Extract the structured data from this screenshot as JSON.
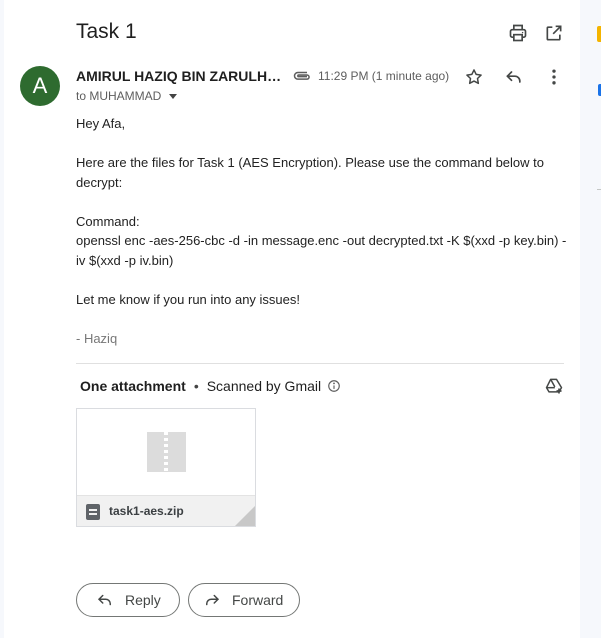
{
  "email": {
    "subject": "Task 1",
    "sender_initial": "A",
    "sender_name": "AMIRUL HAZIQ BIN ZARULHI...",
    "time": "11:29 PM (1 minute ago)",
    "to_line": "to MUHAMMAD",
    "body": [
      "Hey Afa,",
      "",
      "Here are the files for Task 1 (AES Encryption). Please use the command below to decrypt:",
      "",
      "Command:",
      "openssl enc -aes-256-cbc -d -in message.enc -out decrypted.txt -K $(xxd -p key.bin) -iv $(xxd -p iv.bin)",
      "",
      "Let me know if you run into any issues!",
      "",
      "- Haziq"
    ]
  },
  "attachments": {
    "header_count": "One attachment",
    "separator": "•",
    "scanned": "Scanned by Gmail",
    "file_name": "task1-aes.zip"
  },
  "actions": {
    "reply": "Reply",
    "forward": "Forward"
  },
  "icons": {
    "print": "print-icon",
    "open_new": "open-in-new-window-icon",
    "attachment": "paperclip-icon",
    "star": "star-icon",
    "reply": "reply-icon",
    "more": "more-vert-icon",
    "info": "info-icon",
    "drive": "add-to-drive-icon",
    "zip": "zip-file-icon",
    "file": "file-icon",
    "forward": "forward-icon"
  },
  "colors": {
    "avatar": "#2e6b2f",
    "app_background": "#f6f8fc",
    "pane": "#ffffff"
  }
}
